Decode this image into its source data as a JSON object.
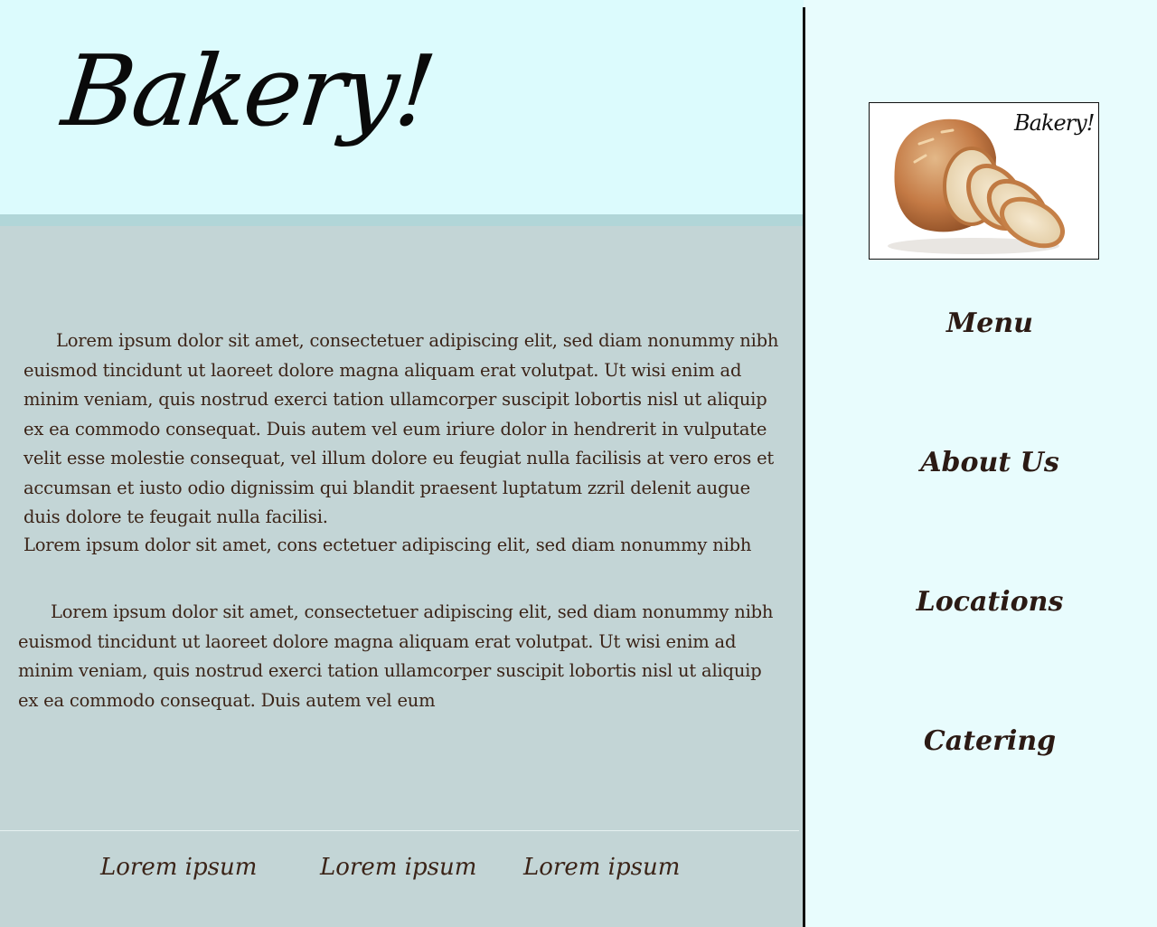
{
  "header": {
    "title": "Bakery!"
  },
  "logo": {
    "text": "Bakery!",
    "image": "sliced-bread-loaf"
  },
  "nav": [
    {
      "label": "Menu"
    },
    {
      "label": "About  Us"
    },
    {
      "label": "Locations"
    },
    {
      "label": "Catering"
    }
  ],
  "content": {
    "paragraphs": [
      "Lorem ipsum dolor sit amet, consectetuer adipiscing elit, sed diam nonummy nibh euismod tincidunt ut laoreet dolore magna aliquam erat volutpat. Ut wisi enim ad minim veniam, quis nostrud exerci tation ullamcorper suscipit lobortis nisl ut aliquip ex ea commodo consequat. Duis autem vel eum iriure dolor in hendrerit in vulputate velit esse molestie consequat, vel illum dolore eu feugiat nulla facilisis at vero eros et accumsan et iusto odio dignissim qui blandit praesent luptatum zzril delenit augue duis dolore te feugait nulla facilisi.",
      "Lorem ipsum dolor sit amet, cons ectetuer adipiscing elit, sed diam nonummy nibh",
      "Lorem ipsum dolor sit amet, consectetuer adipiscing elit, sed diam nonummy nibh euismod tincidunt ut laoreet dolore magna aliquam erat volutpat. Ut wisi enim ad minim veniam, quis nostrud exerci tation ullamcorper suscipit lobortis nisl ut aliquip ex ea commodo consequat. Duis autem vel eum"
    ]
  },
  "footer": {
    "links": [
      {
        "label": "Lorem ipsum"
      },
      {
        "label": "Lorem ipsum"
      },
      {
        "label": "Lorem ipsum"
      }
    ]
  },
  "colors": {
    "header_bg": "#dcfbfd",
    "content_bg": "#c3d5d6",
    "sidebar_bg": "#e8fcfd",
    "text_brown": "#3b2418"
  }
}
